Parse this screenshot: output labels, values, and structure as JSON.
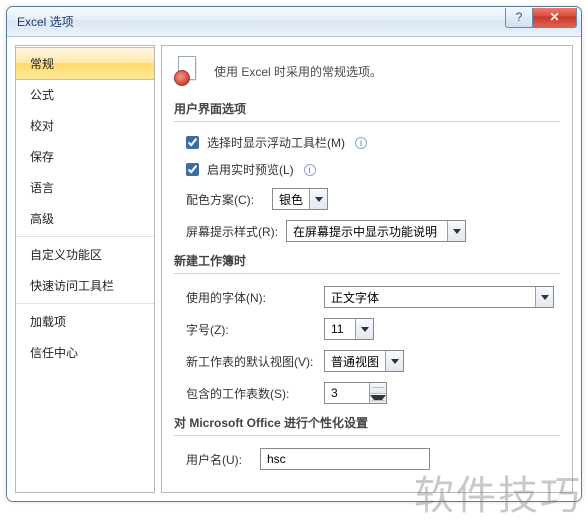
{
  "window": {
    "title": "Excel 选项"
  },
  "titlebar_buttons": {
    "help_glyph": "?",
    "close_glyph": "✕"
  },
  "sidebar": {
    "items": [
      {
        "label": "常规",
        "selected": true
      },
      {
        "label": "公式"
      },
      {
        "label": "校对"
      },
      {
        "label": "保存"
      },
      {
        "label": "语言"
      },
      {
        "label": "高级"
      },
      {
        "label": "自定义功能区",
        "sep_before": true
      },
      {
        "label": "快速访问工具栏"
      },
      {
        "label": "加载项",
        "sep_before": true
      },
      {
        "label": "信任中心"
      }
    ]
  },
  "header": {
    "text": "使用 Excel 时采用的常规选项。"
  },
  "sections": {
    "ui": {
      "title": "用户界面选项",
      "chk_minibar": "选择时显示浮动工具栏(M)",
      "chk_livepreview": "启用实时预览(L)",
      "color_label": "配色方案(C):",
      "color_value": "银色",
      "tooltip_label": "屏幕提示样式(R):",
      "tooltip_value": "在屏幕提示中显示功能说明"
    },
    "newwb": {
      "title": "新建工作簿时",
      "font_label": "使用的字体(N):",
      "font_value": "正文字体",
      "size_label": "字号(Z):",
      "size_value": "11",
      "view_label": "新工作表的默认视图(V):",
      "view_value": "普通视图",
      "sheets_label": "包含的工作表数(S):",
      "sheets_value": "3"
    },
    "personal": {
      "title": "对 Microsoft Office 进行个性化设置",
      "username_label": "用户名(U):",
      "username_value": "hsc"
    }
  },
  "watermark": "软件技巧"
}
